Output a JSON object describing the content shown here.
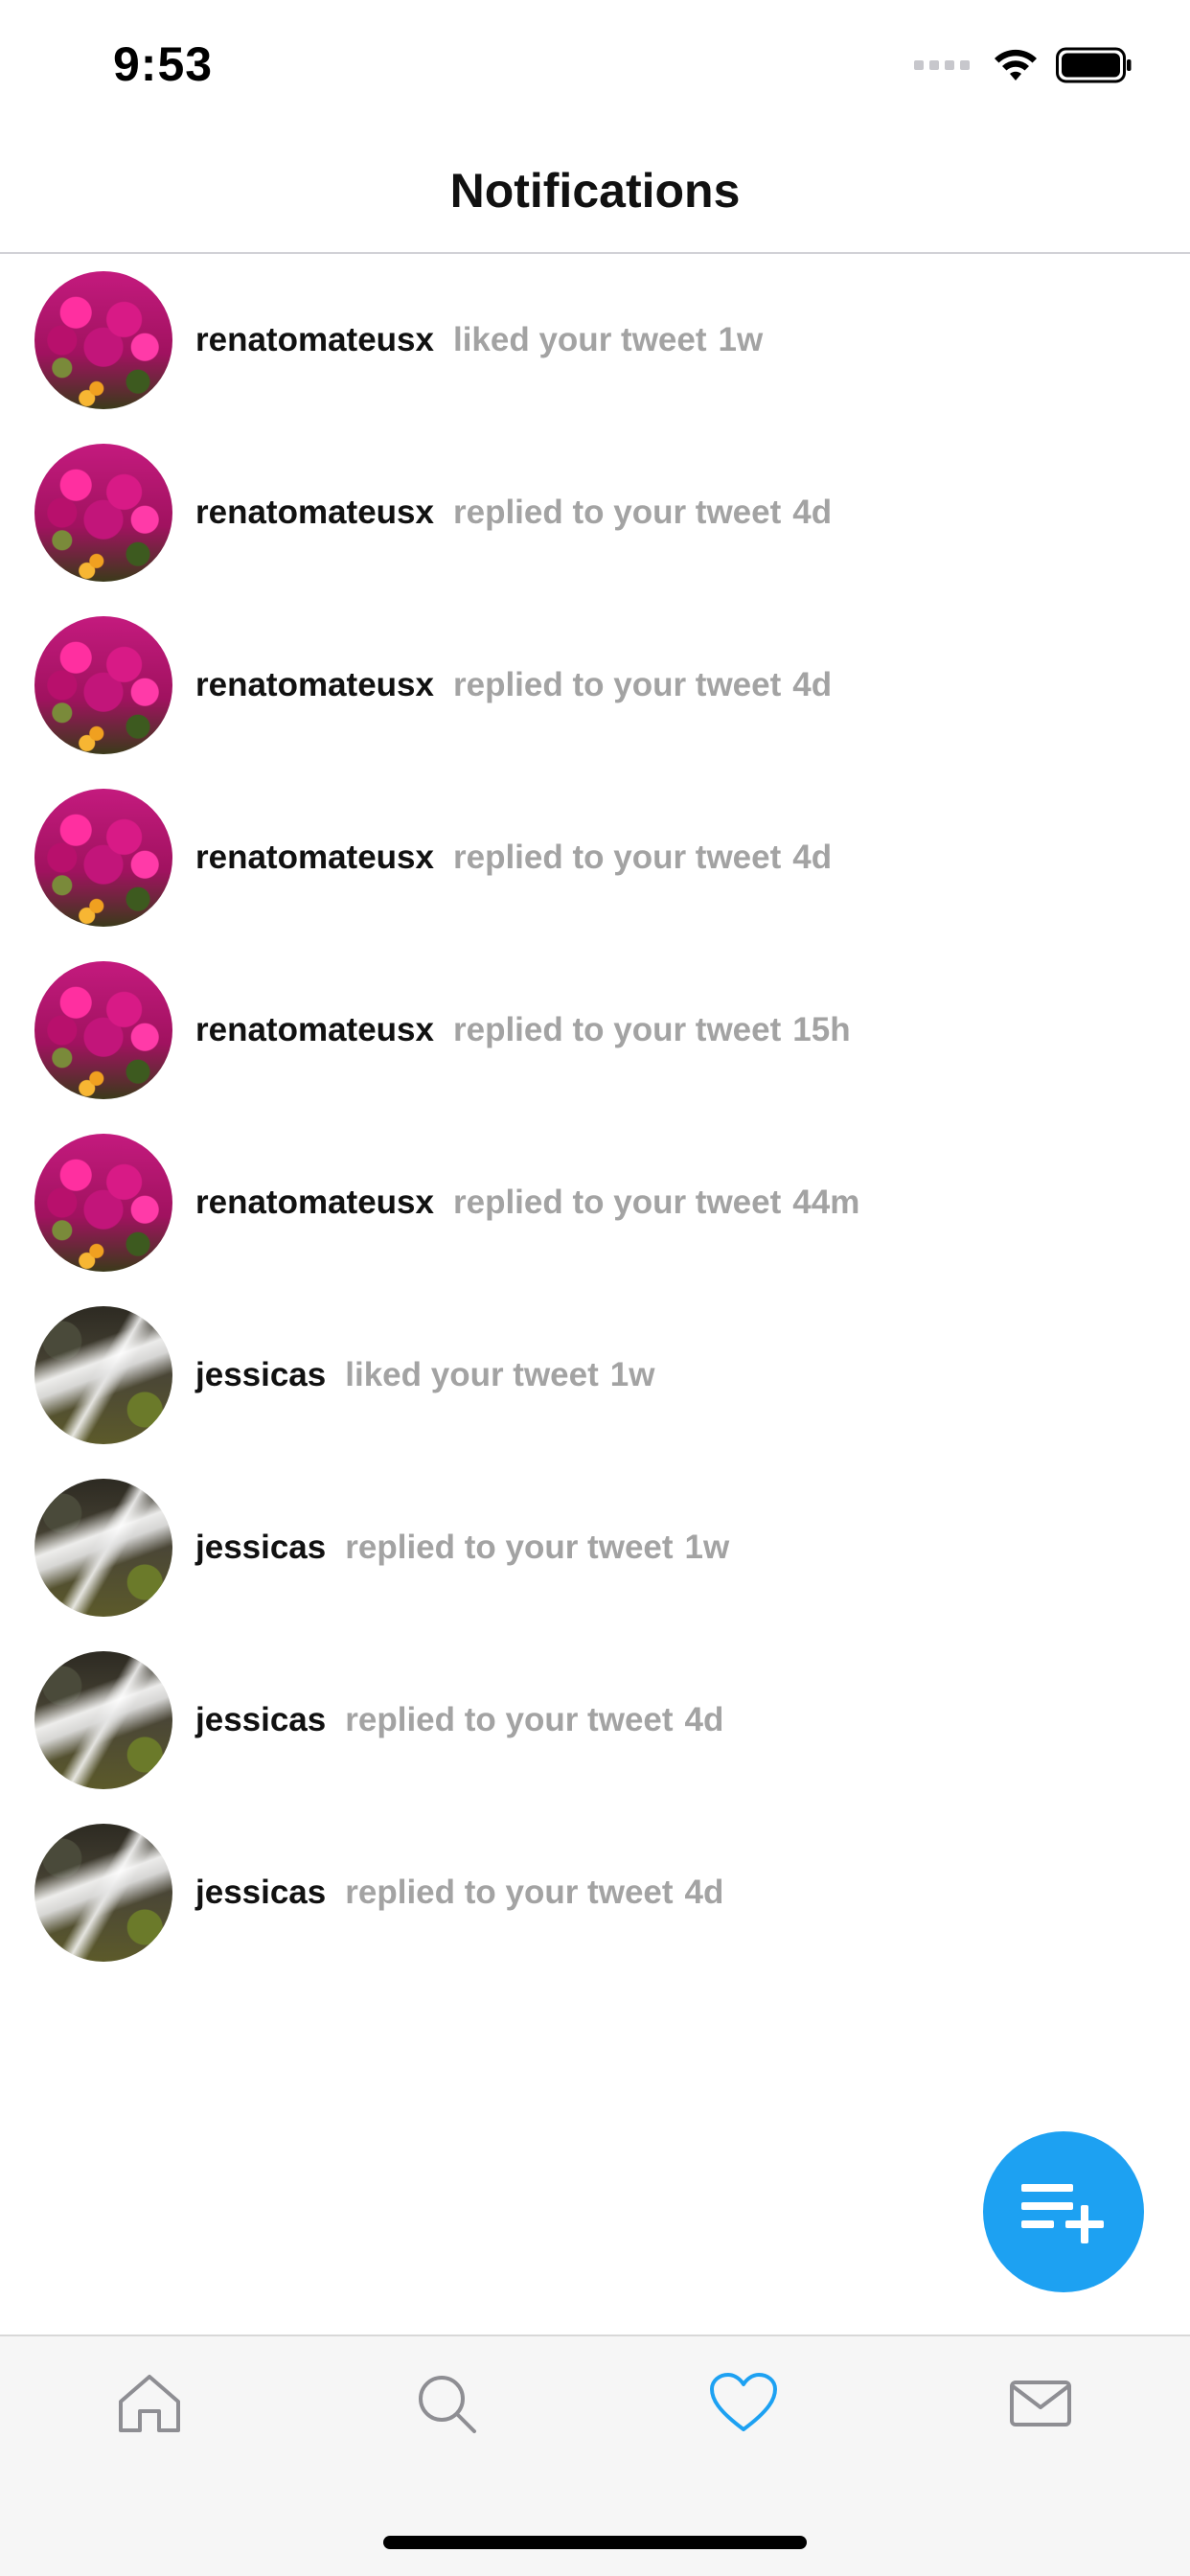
{
  "status_bar": {
    "time": "9:53"
  },
  "header": {
    "title": "Notifications"
  },
  "notifications": [
    {
      "username": "renatomateusx",
      "message": "liked your tweet",
      "time": "1w",
      "avatar": "flowers"
    },
    {
      "username": "renatomateusx",
      "message": "replied to your tweet",
      "time": "4d",
      "avatar": "flowers"
    },
    {
      "username": "renatomateusx",
      "message": "replied to your tweet",
      "time": "4d",
      "avatar": "flowers"
    },
    {
      "username": "renatomateusx",
      "message": "replied to your tweet",
      "time": "4d",
      "avatar": "flowers"
    },
    {
      "username": "renatomateusx",
      "message": "replied to your tweet",
      "time": "15h",
      "avatar": "flowers"
    },
    {
      "username": "renatomateusx",
      "message": "replied to your tweet",
      "time": "44m",
      "avatar": "flowers"
    },
    {
      "username": "jessicas",
      "message": "liked your tweet",
      "time": "1w",
      "avatar": "waterfall"
    },
    {
      "username": "jessicas",
      "message": "replied to your tweet",
      "time": "1w",
      "avatar": "waterfall"
    },
    {
      "username": "jessicas",
      "message": "replied to your tweet",
      "time": "4d",
      "avatar": "waterfall"
    },
    {
      "username": "jessicas",
      "message": "replied to your tweet",
      "time": "4d",
      "avatar": "waterfall"
    }
  ],
  "fab": {
    "icon": "compose-list-plus-icon",
    "color": "#1da1f2"
  },
  "tab_bar": {
    "tabs": [
      {
        "icon": "home-icon",
        "active": false
      },
      {
        "icon": "search-icon",
        "active": false
      },
      {
        "icon": "heart-icon",
        "active": true
      },
      {
        "icon": "mail-icon",
        "active": false
      }
    ],
    "active_color": "#1da1f2",
    "inactive_color": "#8e8e93"
  }
}
